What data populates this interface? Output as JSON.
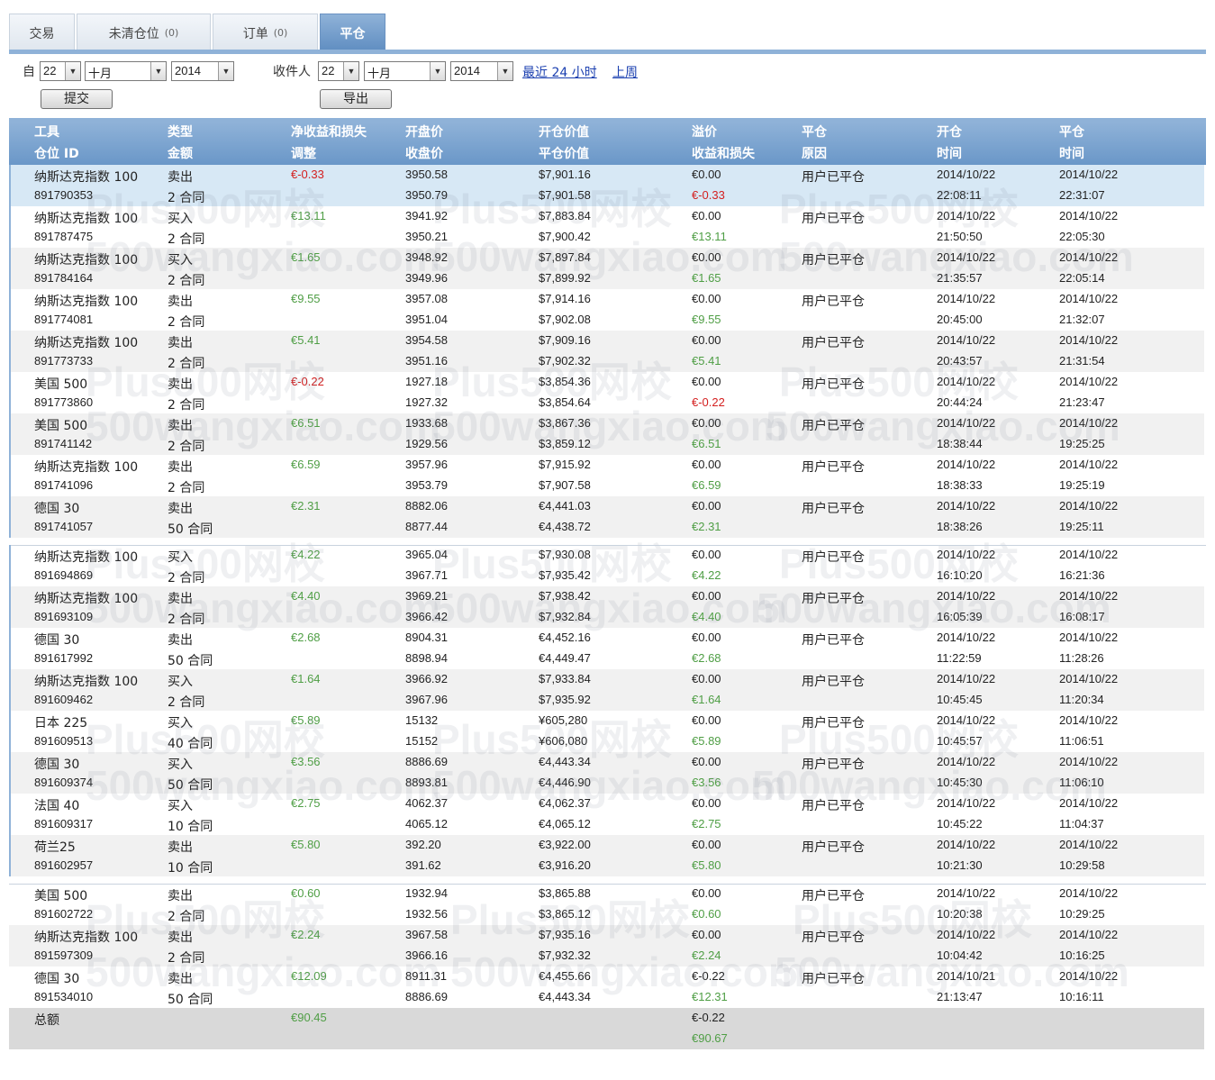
{
  "tabs": [
    {
      "label": "交易",
      "count": ""
    },
    {
      "label": "未清仓位",
      "count": "(0)"
    },
    {
      "label": "订单",
      "count": "(0)"
    },
    {
      "label": "平仓",
      "count": ""
    }
  ],
  "filter": {
    "from_label": "自",
    "from_day": "22",
    "from_month": "十月",
    "from_year": "2014",
    "to_label": "收件人",
    "to_day": "22",
    "to_month": "十月",
    "to_year": "2014",
    "link_24h": "最近 24 小时",
    "link_week": "上周",
    "submit": "提交",
    "export": "导出"
  },
  "headers": [
    [
      "工具",
      "仓位 ID"
    ],
    [
      "类型",
      "金额"
    ],
    [
      "净收益和损失",
      "调整"
    ],
    [
      "开盘价",
      "收盘价"
    ],
    [
      "开仓价值",
      "平仓价值"
    ],
    [
      "溢价",
      "收益和损失"
    ],
    [
      "平仓",
      "原因"
    ],
    [
      "开仓",
      "时间"
    ],
    [
      "平仓",
      "时间"
    ]
  ],
  "rows": [
    {
      "inst": "纳斯达克指数 100",
      "id": "891790353",
      "type": "卖出",
      "amount": "2 合同",
      "pnl": "€-0.33",
      "open": "3950.58",
      "close": "3950.79",
      "ov": "$7,901.16",
      "cv": "$7,901.58",
      "prem": "€0.00",
      "pl": "€-0.33",
      "reason": "用户已平仓",
      "od": "2014/10/22",
      "ot": "22:08:11",
      "cd": "2014/10/22",
      "ct": "22:31:07"
    },
    {
      "inst": "纳斯达克指数 100",
      "id": "891787475",
      "type": "买入",
      "amount": "2 合同",
      "pnl": "€13.11",
      "open": "3941.92",
      "close": "3950.21",
      "ov": "$7,883.84",
      "cv": "$7,900.42",
      "prem": "€0.00",
      "pl": "€13.11",
      "reason": "用户已平仓",
      "od": "2014/10/22",
      "ot": "21:50:50",
      "cd": "2014/10/22",
      "ct": "22:05:30"
    },
    {
      "inst": "纳斯达克指数 100",
      "id": "891784164",
      "type": "买入",
      "amount": "2 合同",
      "pnl": "€1.65",
      "open": "3948.92",
      "close": "3949.96",
      "ov": "$7,897.84",
      "cv": "$7,899.92",
      "prem": "€0.00",
      "pl": "€1.65",
      "reason": "用户已平仓",
      "od": "2014/10/22",
      "ot": "21:35:57",
      "cd": "2014/10/22",
      "ct": "22:05:14"
    },
    {
      "inst": "纳斯达克指数 100",
      "id": "891774081",
      "type": "卖出",
      "amount": "2 合同",
      "pnl": "€9.55",
      "open": "3957.08",
      "close": "3951.04",
      "ov": "$7,914.16",
      "cv": "$7,902.08",
      "prem": "€0.00",
      "pl": "€9.55",
      "reason": "用户已平仓",
      "od": "2014/10/22",
      "ot": "20:45:00",
      "cd": "2014/10/22",
      "ct": "21:32:07"
    },
    {
      "inst": "纳斯达克指数 100",
      "id": "891773733",
      "type": "卖出",
      "amount": "2 合同",
      "pnl": "€5.41",
      "open": "3954.58",
      "close": "3951.16",
      "ov": "$7,909.16",
      "cv": "$7,902.32",
      "prem": "€0.00",
      "pl": "€5.41",
      "reason": "用户已平仓",
      "od": "2014/10/22",
      "ot": "20:43:57",
      "cd": "2014/10/22",
      "ct": "21:31:54"
    },
    {
      "inst": "美国 500",
      "id": "891773860",
      "type": "卖出",
      "amount": "2 合同",
      "pnl": "€-0.22",
      "open": "1927.18",
      "close": "1927.32",
      "ov": "$3,854.36",
      "cv": "$3,854.64",
      "prem": "€0.00",
      "pl": "€-0.22",
      "reason": "用户已平仓",
      "od": "2014/10/22",
      "ot": "20:44:24",
      "cd": "2014/10/22",
      "ct": "21:23:47"
    },
    {
      "inst": "美国 500",
      "id": "891741142",
      "type": "卖出",
      "amount": "2 合同",
      "pnl": "€6.51",
      "open": "1933.68",
      "close": "1929.56",
      "ov": "$3,867.36",
      "cv": "$3,859.12",
      "prem": "€0.00",
      "pl": "€6.51",
      "reason": "用户已平仓",
      "od": "2014/10/22",
      "ot": "18:38:44",
      "cd": "2014/10/22",
      "ct": "19:25:25"
    },
    {
      "inst": "纳斯达克指数 100",
      "id": "891741096",
      "type": "卖出",
      "amount": "2 合同",
      "pnl": "€6.59",
      "open": "3957.96",
      "close": "3953.79",
      "ov": "$7,915.92",
      "cv": "$7,907.58",
      "prem": "€0.00",
      "pl": "€6.59",
      "reason": "用户已平仓",
      "od": "2014/10/22",
      "ot": "18:38:33",
      "cd": "2014/10/22",
      "ct": "19:25:19"
    },
    {
      "inst": "德国 30",
      "id": "891741057",
      "type": "卖出",
      "amount": "50 合同",
      "pnl": "€2.31",
      "open": "8882.06",
      "close": "8877.44",
      "ov": "€4,441.03",
      "cv": "€4,438.72",
      "prem": "€0.00",
      "pl": "€2.31",
      "reason": "用户已平仓",
      "od": "2014/10/22",
      "ot": "18:38:26",
      "cd": "2014/10/22",
      "ct": "19:25:11"
    },
    {
      "inst": "纳斯达克指数 100",
      "id": "891694869",
      "type": "买入",
      "amount": "2 合同",
      "pnl": "€4.22",
      "open": "3965.04",
      "close": "3967.71",
      "ov": "$7,930.08",
      "cv": "$7,935.42",
      "prem": "€0.00",
      "pl": "€4.22",
      "reason": "用户已平仓",
      "od": "2014/10/22",
      "ot": "16:10:20",
      "cd": "2014/10/22",
      "ct": "16:21:36"
    },
    {
      "inst": "纳斯达克指数 100",
      "id": "891693109",
      "type": "卖出",
      "amount": "2 合同",
      "pnl": "€4.40",
      "open": "3969.21",
      "close": "3966.42",
      "ov": "$7,938.42",
      "cv": "$7,932.84",
      "prem": "€0.00",
      "pl": "€4.40",
      "reason": "用户已平仓",
      "od": "2014/10/22",
      "ot": "16:05:39",
      "cd": "2014/10/22",
      "ct": "16:08:17"
    },
    {
      "inst": "德国 30",
      "id": "891617992",
      "type": "卖出",
      "amount": "50 合同",
      "pnl": "€2.68",
      "open": "8904.31",
      "close": "8898.94",
      "ov": "€4,452.16",
      "cv": "€4,449.47",
      "prem": "€0.00",
      "pl": "€2.68",
      "reason": "用户已平仓",
      "od": "2014/10/22",
      "ot": "11:22:59",
      "cd": "2014/10/22",
      "ct": "11:28:26"
    },
    {
      "inst": "纳斯达克指数 100",
      "id": "891609462",
      "type": "买入",
      "amount": "2 合同",
      "pnl": "€1.64",
      "open": "3966.92",
      "close": "3967.96",
      "ov": "$7,933.84",
      "cv": "$7,935.92",
      "prem": "€0.00",
      "pl": "€1.64",
      "reason": "用户已平仓",
      "od": "2014/10/22",
      "ot": "10:45:45",
      "cd": "2014/10/22",
      "ct": "11:20:34"
    },
    {
      "inst": "日本 225",
      "id": "891609513",
      "type": "买入",
      "amount": "40 合同",
      "pnl": "€5.89",
      "open": "15132",
      "close": "15152",
      "ov": "¥605,280",
      "cv": "¥606,080",
      "prem": "€0.00",
      "pl": "€5.89",
      "reason": "用户已平仓",
      "od": "2014/10/22",
      "ot": "10:45:57",
      "cd": "2014/10/22",
      "ct": "11:06:51"
    },
    {
      "inst": "德国 30",
      "id": "891609374",
      "type": "买入",
      "amount": "50 合同",
      "pnl": "€3.56",
      "open": "8886.69",
      "close": "8893.81",
      "ov": "€4,443.34",
      "cv": "€4,446.90",
      "prem": "€0.00",
      "pl": "€3.56",
      "reason": "用户已平仓",
      "od": "2014/10/22",
      "ot": "10:45:30",
      "cd": "2014/10/22",
      "ct": "11:06:10"
    },
    {
      "inst": "法国 40",
      "id": "891609317",
      "type": "买入",
      "amount": "10 合同",
      "pnl": "€2.75",
      "open": "4062.37",
      "close": "4065.12",
      "ov": "€4,062.37",
      "cv": "€4,065.12",
      "prem": "€0.00",
      "pl": "€2.75",
      "reason": "用户已平仓",
      "od": "2014/10/22",
      "ot": "10:45:22",
      "cd": "2014/10/22",
      "ct": "11:04:37"
    },
    {
      "inst": "荷兰25",
      "id": "891602957",
      "type": "卖出",
      "amount": "10 合同",
      "pnl": "€5.80",
      "open": "392.20",
      "close": "391.62",
      "ov": "€3,922.00",
      "cv": "€3,916.20",
      "prem": "€0.00",
      "pl": "€5.80",
      "reason": "用户已平仓",
      "od": "2014/10/22",
      "ot": "10:21:30",
      "cd": "2014/10/22",
      "ct": "10:29:58"
    },
    {
      "inst": "美国 500",
      "id": "891602722",
      "type": "卖出",
      "amount": "2 合同",
      "pnl": "€0.60",
      "open": "1932.94",
      "close": "1932.56",
      "ov": "$3,865.88",
      "cv": "$3,865.12",
      "prem": "€0.00",
      "pl": "€0.60",
      "reason": "用户已平仓",
      "od": "2014/10/22",
      "ot": "10:20:38",
      "cd": "2014/10/22",
      "ct": "10:29:25"
    },
    {
      "inst": "纳斯达克指数 100",
      "id": "891597309",
      "type": "卖出",
      "amount": "2 合同",
      "pnl": "€2.24",
      "open": "3967.58",
      "close": "3966.16",
      "ov": "$7,935.16",
      "cv": "$7,932.32",
      "prem": "€0.00",
      "pl": "€2.24",
      "reason": "用户已平仓",
      "od": "2014/10/22",
      "ot": "10:04:42",
      "cd": "2014/10/22",
      "ct": "10:16:25"
    },
    {
      "inst": "德国 30",
      "id": "891534010",
      "type": "卖出",
      "amount": "50 合同",
      "pnl": "€12.09",
      "open": "8911.31",
      "close": "8886.69",
      "ov": "€4,455.66",
      "cv": "€4,443.34",
      "prem": "€-0.22",
      "pl": "€12.31",
      "reason": "用户已平仓",
      "od": "2014/10/21",
      "ot": "21:13:47",
      "cd": "2014/10/22",
      "ct": "10:16:11"
    }
  ],
  "total": {
    "label": "总额",
    "pnl": "€90.45",
    "prem": "€-0.22",
    "pl": "€90.67"
  },
  "colors": {
    "accent": "#8fb2d8",
    "header_dark": "#6a97c8",
    "positive": "#4f9e45",
    "negative": "#d41f1f",
    "selected_row": "#d7e8f5",
    "alt_row": "#f1f1f1",
    "total_row": "#d9d9d9",
    "link": "#1a3fb0"
  }
}
